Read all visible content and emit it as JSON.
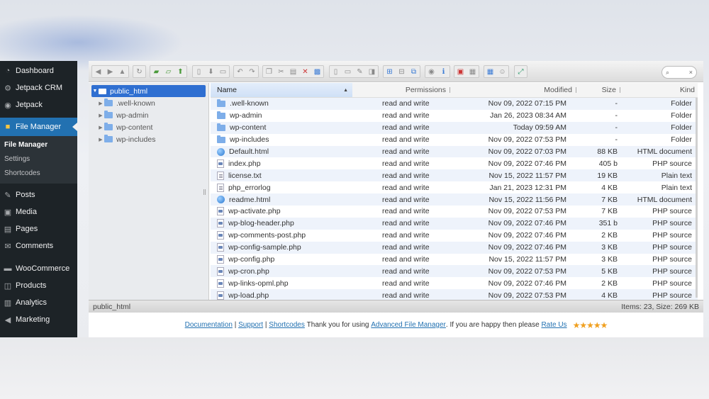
{
  "sidebar": {
    "items": [
      {
        "label": "Dashboard",
        "icon": "dashboard-icon"
      },
      {
        "label": "Jetpack CRM",
        "icon": "gear-icon"
      },
      {
        "label": "Jetpack",
        "icon": "jetpack-icon"
      },
      {
        "label": "File Manager",
        "icon": "folder-icon",
        "active": true
      },
      {
        "label": "Posts",
        "icon": "pin-icon"
      },
      {
        "label": "Media",
        "icon": "media-icon"
      },
      {
        "label": "Pages",
        "icon": "pages-icon"
      },
      {
        "label": "Comments",
        "icon": "comment-icon"
      },
      {
        "label": "WooCommerce",
        "icon": "woo-icon"
      },
      {
        "label": "Products",
        "icon": "box-icon"
      },
      {
        "label": "Analytics",
        "icon": "bar-chart-icon"
      },
      {
        "label": "Marketing",
        "icon": "megaphone-icon"
      }
    ],
    "submenu": [
      "File Manager",
      "Settings",
      "Shortcodes"
    ]
  },
  "search": {
    "clear": "×"
  },
  "tree": {
    "root": "public_html",
    "children": [
      ".well-known",
      "wp-admin",
      "wp-content",
      "wp-includes"
    ]
  },
  "list": {
    "headers": {
      "name": "Name",
      "permissions": "Permissions",
      "modified": "Modified",
      "size": "Size",
      "kind": "Kind"
    },
    "rows": [
      {
        "name": ".well-known",
        "perm": "read and write",
        "mod": "Nov 09, 2022 07:15 PM",
        "size": "-",
        "kind": "Folder",
        "type": "dir"
      },
      {
        "name": "wp-admin",
        "perm": "read and write",
        "mod": "Jan 26, 2023 08:34 AM",
        "size": "-",
        "kind": "Folder",
        "type": "dir"
      },
      {
        "name": "wp-content",
        "perm": "read and write",
        "mod": "Today 09:59 AM",
        "size": "-",
        "kind": "Folder",
        "type": "dir"
      },
      {
        "name": "wp-includes",
        "perm": "read and write",
        "mod": "Nov 09, 2022 07:53 PM",
        "size": "-",
        "kind": "Folder",
        "type": "dir"
      },
      {
        "name": "Default.html",
        "perm": "read and write",
        "mod": "Nov 09, 2022 07:03 PM",
        "size": "88 KB",
        "kind": "HTML document",
        "type": "html"
      },
      {
        "name": "index.php",
        "perm": "read and write",
        "mod": "Nov 09, 2022 07:46 PM",
        "size": "405 b",
        "kind": "PHP source",
        "type": "php"
      },
      {
        "name": "license.txt",
        "perm": "read and write",
        "mod": "Nov 15, 2022 11:57 PM",
        "size": "19 KB",
        "kind": "Plain text",
        "type": "txt"
      },
      {
        "name": "php_errorlog",
        "perm": "read and write",
        "mod": "Jan 21, 2023 12:31 PM",
        "size": "4 KB",
        "kind": "Plain text",
        "type": "txt"
      },
      {
        "name": "readme.html",
        "perm": "read and write",
        "mod": "Nov 15, 2022 11:56 PM",
        "size": "7 KB",
        "kind": "HTML document",
        "type": "html"
      },
      {
        "name": "wp-activate.php",
        "perm": "read and write",
        "mod": "Nov 09, 2022 07:53 PM",
        "size": "7 KB",
        "kind": "PHP source",
        "type": "php"
      },
      {
        "name": "wp-blog-header.php",
        "perm": "read and write",
        "mod": "Nov 09, 2022 07:46 PM",
        "size": "351 b",
        "kind": "PHP source",
        "type": "php"
      },
      {
        "name": "wp-comments-post.php",
        "perm": "read and write",
        "mod": "Nov 09, 2022 07:46 PM",
        "size": "2 KB",
        "kind": "PHP source",
        "type": "php"
      },
      {
        "name": "wp-config-sample.php",
        "perm": "read and write",
        "mod": "Nov 09, 2022 07:46 PM",
        "size": "3 KB",
        "kind": "PHP source",
        "type": "php"
      },
      {
        "name": "wp-config.php",
        "perm": "read and write",
        "mod": "Nov 15, 2022 11:57 PM",
        "size": "3 KB",
        "kind": "PHP source",
        "type": "php"
      },
      {
        "name": "wp-cron.php",
        "perm": "read and write",
        "mod": "Nov 09, 2022 07:53 PM",
        "size": "5 KB",
        "kind": "PHP source",
        "type": "php"
      },
      {
        "name": "wp-links-opml.php",
        "perm": "read and write",
        "mod": "Nov 09, 2022 07:46 PM",
        "size": "2 KB",
        "kind": "PHP source",
        "type": "php"
      },
      {
        "name": "wp-load.php",
        "perm": "read and write",
        "mod": "Nov 09, 2022 07:53 PM",
        "size": "4 KB",
        "kind": "PHP source",
        "type": "php"
      }
    ]
  },
  "status": {
    "path": "public_html",
    "summary": "Items: 23, Size: 269 KB"
  },
  "footer": {
    "documentation": "Documentation",
    "sep1": "|",
    "support": "Support",
    "sep2": "|",
    "shortcodes": "Shortcodes",
    "thanks": "Thank you for using",
    "product": "Advanced File Manager",
    "happy": ". If you are happy then please",
    "rate": "Rate Us",
    "stars": "★★★★★"
  }
}
